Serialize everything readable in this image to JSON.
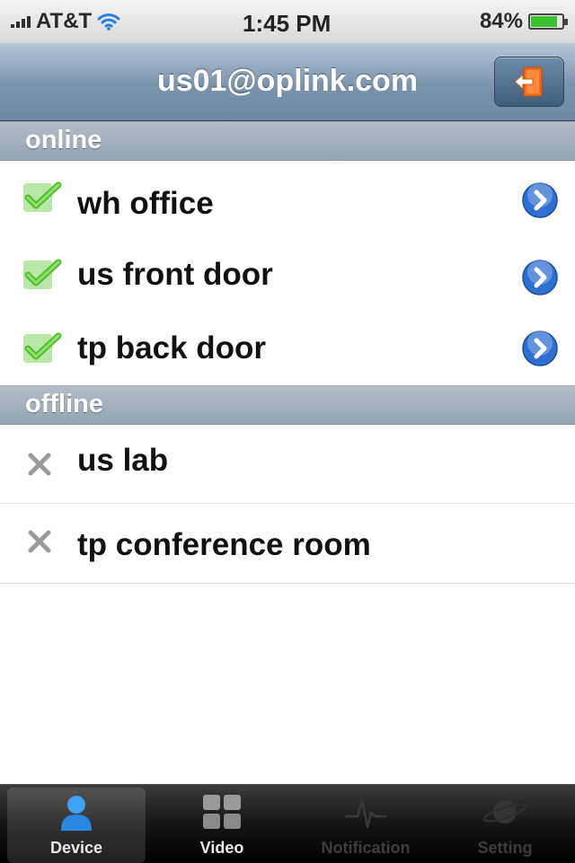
{
  "status_bar": {
    "carrier": "AT&T",
    "time": "1:45 PM",
    "battery_percent": "84%",
    "battery_level": 0.84,
    "icons": [
      "signal-icon",
      "wifi-icon",
      "battery-icon"
    ]
  },
  "nav": {
    "title": "us01@oplink.com",
    "logout_icon": "logout-icon",
    "logout_color": "#f26a1b"
  },
  "sections": {
    "online": {
      "header": "online",
      "items": [
        {
          "name": "wh office",
          "status_icon": "check-icon",
          "accessory": "disclosure-icon"
        },
        {
          "name": "us front door",
          "status_icon": "check-icon",
          "accessory": "disclosure-icon"
        },
        {
          "name": "tp back door",
          "status_icon": "check-icon",
          "accessory": "disclosure-icon"
        }
      ]
    },
    "offline": {
      "header": "offline",
      "items": [
        {
          "name": "us lab",
          "status_icon": "x-icon"
        },
        {
          "name": "tp conference room",
          "status_icon": "x-icon"
        }
      ]
    }
  },
  "tab_bar": {
    "tabs": [
      {
        "label": "Device",
        "icon": "person-icon",
        "active": true
      },
      {
        "label": "Video",
        "icon": "grid-icon",
        "active": false
      },
      {
        "label": "Notification",
        "icon": "pulse-icon",
        "active": false
      },
      {
        "label": "Setting",
        "icon": "planet-icon",
        "active": false
      }
    ]
  },
  "colors": {
    "online_check": "#4fbf2d",
    "disclosure_blue": "#2f6fd0",
    "nav_bar": "#7b93ad",
    "section_header": "#a5b1be"
  }
}
